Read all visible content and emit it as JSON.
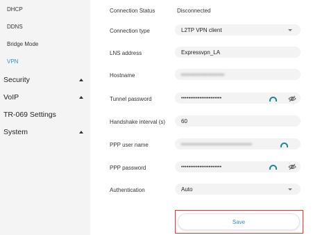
{
  "sidebar": {
    "sub_items": [
      {
        "label": "DHCP"
      },
      {
        "label": "DDNS"
      },
      {
        "label": "Bridge Mode"
      },
      {
        "label": "VPN"
      }
    ],
    "main_items": [
      {
        "label": "Security",
        "icon": "chevron-up-icon"
      },
      {
        "label": "VoIP",
        "icon": "chevron-up-icon"
      },
      {
        "label": "TR-069 Settings"
      },
      {
        "label": "System",
        "icon": "chevron-up-icon"
      }
    ]
  },
  "form": {
    "connection_status": {
      "label": "Connection Status",
      "value": "Disconnected"
    },
    "connection_type": {
      "label": "Connection type",
      "value": "L2TP VPN client"
    },
    "lns_address": {
      "label": "LNS address",
      "value": "Expressvpn_LA"
    },
    "hostname": {
      "label": "Hostname",
      "value": "•••••••••••••••••••"
    },
    "tunnel_password": {
      "label": "Tunnel password",
      "value": "••••••••••••••••••••••"
    },
    "handshake_interval": {
      "label": "Handshake interval (s)",
      "value": "60"
    },
    "ppp_user_name": {
      "label": "PPP user name",
      "value": "•••••••••••••••••••••••••••••••"
    },
    "ppp_password": {
      "label": "PPP password",
      "value": "••••••••••••••••••••••"
    },
    "authentication": {
      "label": "Authentication",
      "value": "Auto"
    }
  },
  "save_label": "Save",
  "colors": {
    "accent": "#2d8fd5",
    "sidebar_bg": "#f4f4f4",
    "field_bg": "#f3f3f3",
    "highlight": "#e03636",
    "icon_teal": "#1a8a90"
  }
}
